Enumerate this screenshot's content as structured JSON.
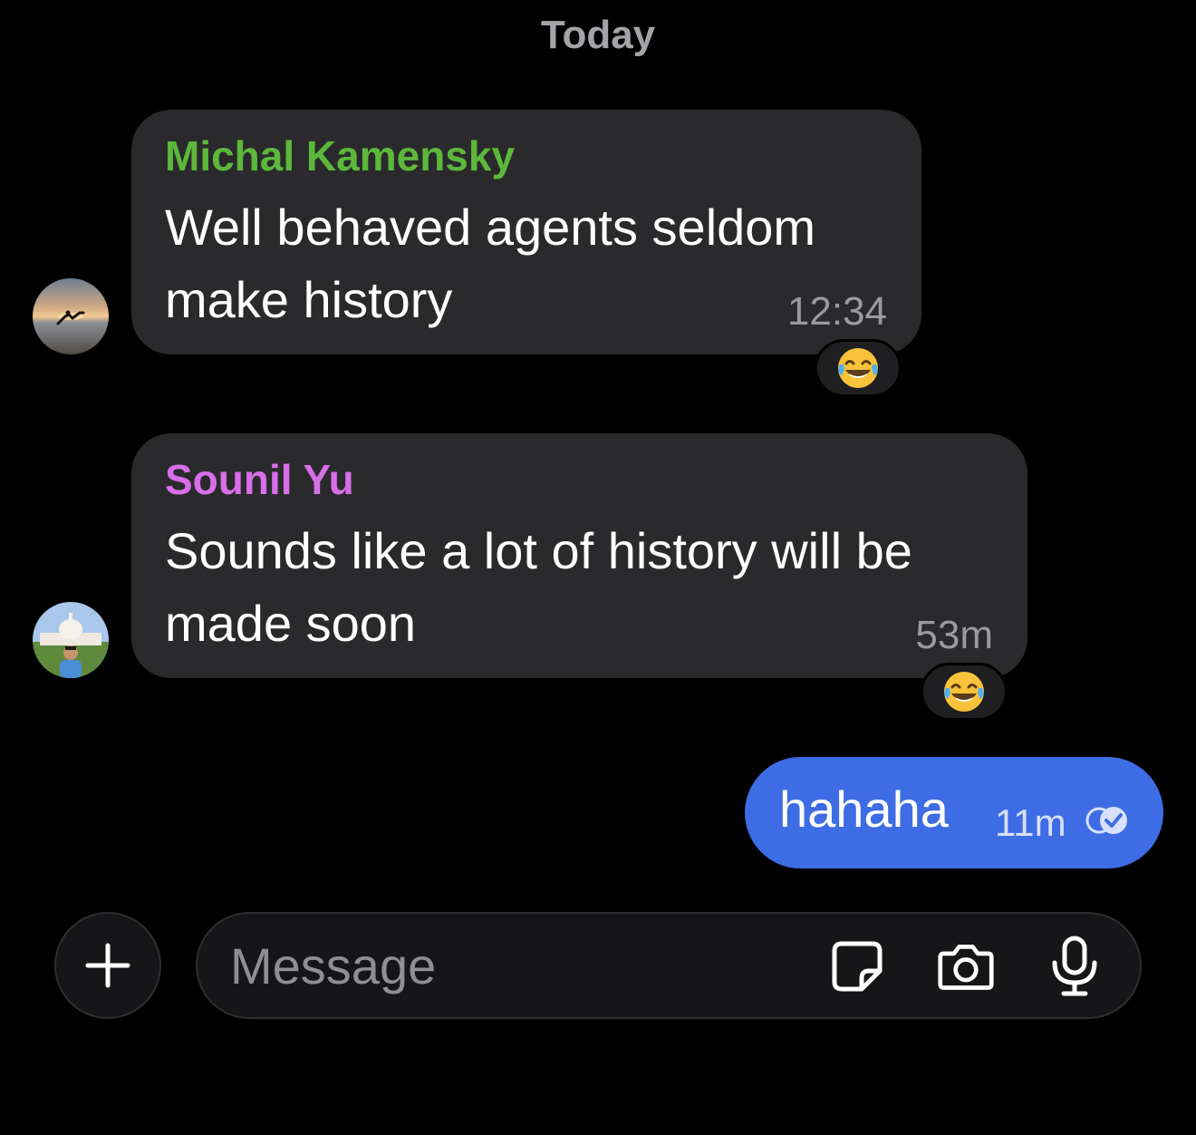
{
  "date_divider": "Today",
  "messages": [
    {
      "sender": "Michal Kamensky",
      "sender_color": "#5cb83b",
      "text": "Well behaved agents seldom make history",
      "time": "12:34",
      "reaction": "face-with-tears-of-joy-emoji",
      "avatar": "sunset-beach-yoga-photo"
    },
    {
      "sender": "Sounil Yu",
      "sender_color": "#d86ee8",
      "text": "Sounds like a lot of history will be made soon",
      "time": "53m",
      "reaction": "face-with-tears-of-joy-emoji",
      "avatar": "capitol-building-portrait-photo"
    }
  ],
  "outgoing": {
    "text": "hahaha",
    "time": "11m",
    "status_icon": "read-receipt-icon",
    "color": "#3e6ce4"
  },
  "composer": {
    "placeholder": "Message",
    "value": "",
    "icons": [
      "plus-icon",
      "sticker-icon",
      "camera-icon",
      "microphone-icon"
    ]
  }
}
